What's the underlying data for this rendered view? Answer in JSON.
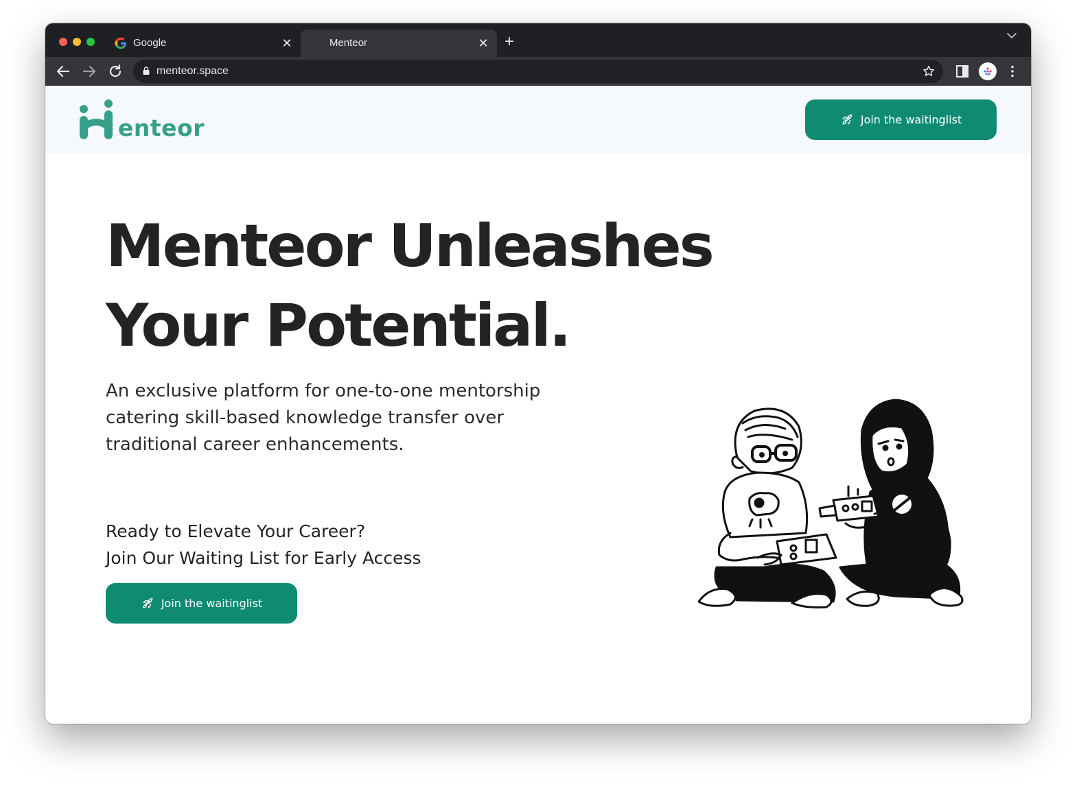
{
  "browser": {
    "tabs": [
      {
        "title": "Google",
        "icon": "google-g-icon"
      },
      {
        "title": "Menteor",
        "icon": "none"
      }
    ],
    "new_tab_symbol": "+",
    "url": "menteor.space"
  },
  "nav": {
    "logo_text": "enteor",
    "logo_mark": "M",
    "button_label": "Join the waitinglist"
  },
  "hero": {
    "title_line1": "Menteor Unleashes",
    "title_line2": "Your Potential.",
    "description": "An exclusive platform for one-to-one mentorship catering skill-based knowledge transfer over traditional career enhancements.",
    "cta_line1": "Ready to Elevate Your Career?",
    "cta_line2": "Join Our Waiting List for Early Access",
    "cta_button_label": "Join the waitinglist",
    "illustration": "two-people-sitting-with-robot-kit"
  },
  "colors": {
    "brand": "#0f8b73",
    "logo": "#36a08a",
    "nav_bg": "#f5f8fc",
    "chrome_dark": "#1f2023",
    "chrome_toolbar": "#35363a"
  }
}
